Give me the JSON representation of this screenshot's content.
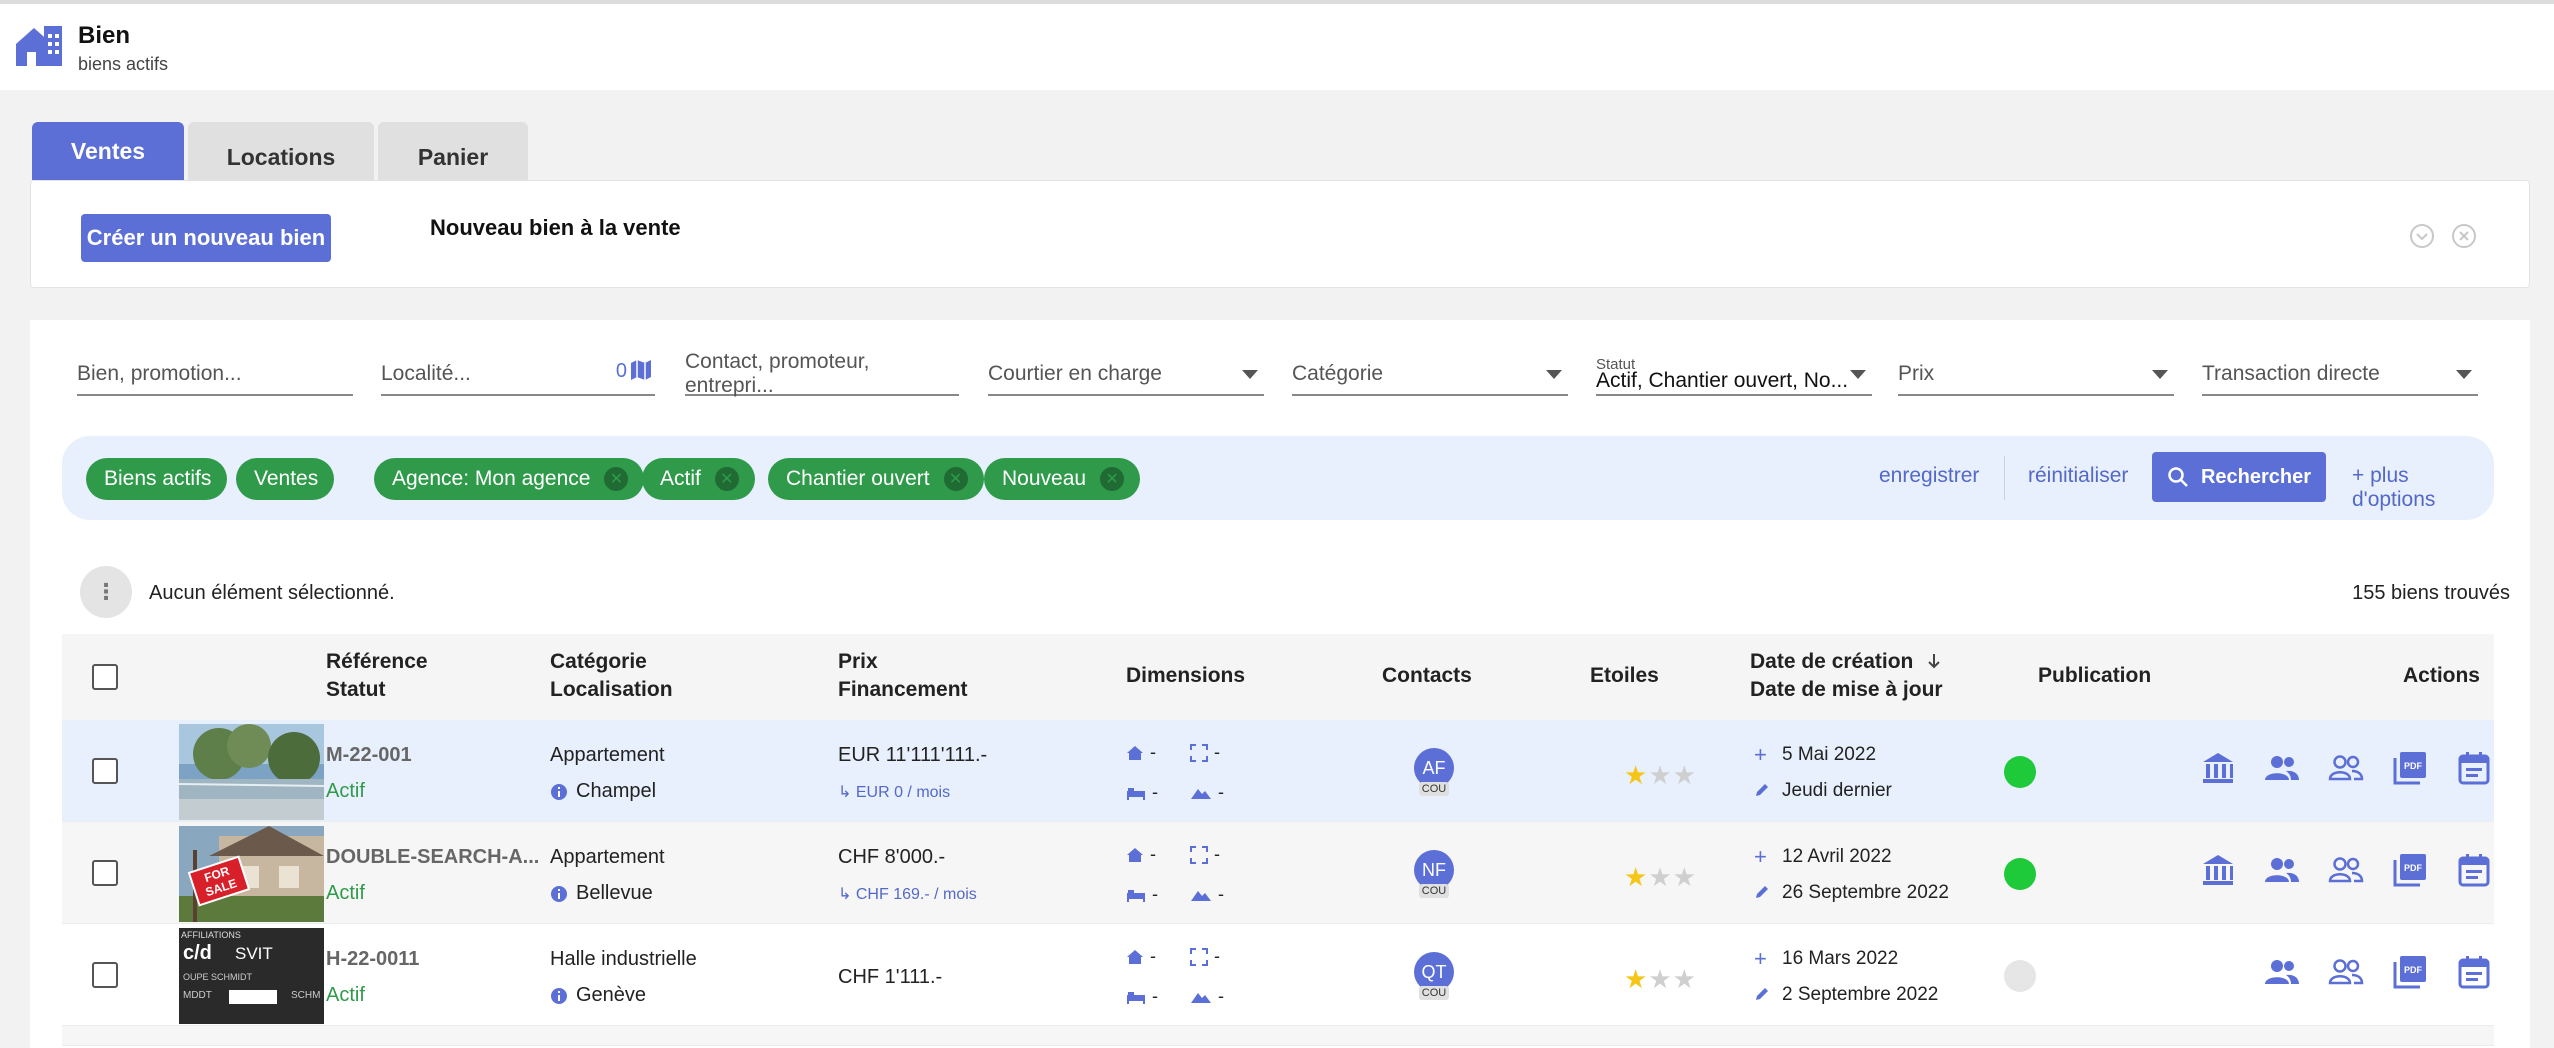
{
  "header": {
    "title": "Bien",
    "subtitle": "biens actifs"
  },
  "tabs": [
    {
      "label": "Ventes"
    },
    {
      "label": "Locations"
    },
    {
      "label": "Panier"
    }
  ],
  "create": {
    "button_label": "Créer un nouveau bien",
    "title": "Nouveau bien à la vente"
  },
  "filters": {
    "bien_placeholder": "Bien, promotion...",
    "localite_placeholder": "Localité...",
    "localite_count": "0",
    "contact_placeholder": "Contact, promoteur, entrepri...",
    "courtier_label": "Courtier en charge",
    "categorie_label": "Catégorie",
    "statut_label": "Statut",
    "statut_value": "Actif, Chantier ouvert, No...",
    "prix_label": "Prix",
    "transaction_label": "Transaction directe"
  },
  "chips": [
    {
      "label": "Biens actifs",
      "removable": false
    },
    {
      "label": "Ventes",
      "removable": false
    },
    {
      "label": "Agence: Mon agence",
      "removable": true
    },
    {
      "label": "Actif",
      "removable": true
    },
    {
      "label": "Chantier ouvert",
      "removable": true
    },
    {
      "label": "Nouveau",
      "removable": true
    }
  ],
  "actions_bar": {
    "save": "enregistrer",
    "reset": "réinitialiser",
    "search": "Rechercher",
    "more": "+ plus d'options"
  },
  "selection": {
    "text": "Aucun élément sélectionné.",
    "count": "155 biens trouvés"
  },
  "columns": {
    "ref": "Référence",
    "status": "Statut",
    "cat": "Catégorie",
    "loc": "Localisation",
    "prix": "Prix",
    "fin": "Financement",
    "dim": "Dimensions",
    "contacts": "Contacts",
    "stars": "Etoiles",
    "created": "Date de création",
    "updated": "Date de mise à jour",
    "pub": "Publication",
    "actions": "Actions"
  },
  "rows": [
    {
      "ref": "M-22-001",
      "status": "Actif",
      "category": "Appartement",
      "location": "Champel",
      "price": "EUR 11'111'111.-",
      "financing": "EUR 0 / mois",
      "dim_dash": "-",
      "contact_initials": "AF",
      "contact_tag": "COU",
      "stars": 1,
      "created": "5 Mai 2022",
      "updated": "Jeudi dernier",
      "published": true,
      "pub_color": "#1ec93a"
    },
    {
      "ref": "DOUBLE-SEARCH-A...",
      "status": "Actif",
      "category": "Appartement",
      "location": "Bellevue",
      "price": "CHF 8'000.-",
      "financing": "CHF 169.- / mois",
      "dim_dash": "-",
      "contact_initials": "NF",
      "contact_tag": "COU",
      "stars": 1,
      "created": "12 Avril 2022",
      "updated": "26 Septembre 2022",
      "published": true,
      "pub_color": "#1ec93a"
    },
    {
      "ref": "H-22-0011",
      "status": "Actif",
      "category": "Halle industrielle",
      "location": "Genève",
      "price": "CHF 1'111.-",
      "financing": "",
      "dim_dash": "-",
      "contact_initials": "QT",
      "contact_tag": "COU",
      "stars": 1,
      "created": "16 Mars 2022",
      "updated": "2 Septembre 2022",
      "published": false,
      "pub_color": "#e6e6e6"
    }
  ],
  "thumb3": {
    "line1": "AFFILIATIONS",
    "line2": "c/d",
    "line3": "SVIT",
    "line4": "OUPE SCHMIDT",
    "line5": "MDDT",
    "line6": "SCHM"
  },
  "thumb2": {
    "sign": "FOR SALE"
  },
  "colors": {
    "accent": "#5b6fd6",
    "chip": "#2f9a4a",
    "star": "#f5c518"
  }
}
